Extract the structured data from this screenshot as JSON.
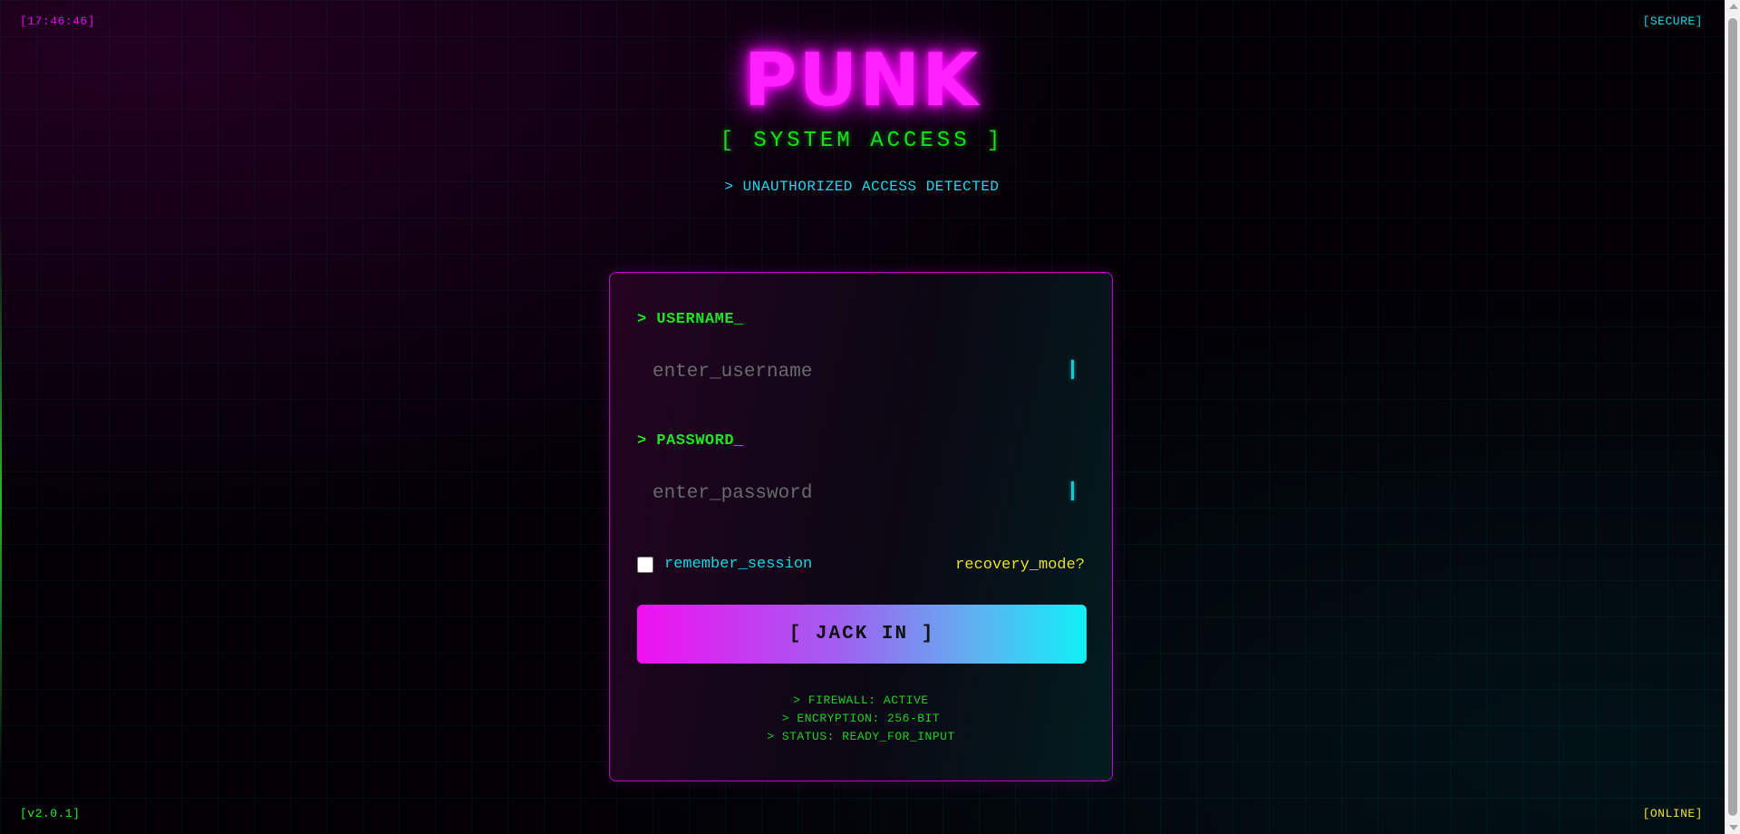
{
  "hud": {
    "clock": "[17:46:46]",
    "security": "[SECURE]",
    "version": "[v2.0.1]",
    "connection": "[ONLINE]"
  },
  "header": {
    "logo": "PUNK",
    "subtitle": "[ SYSTEM ACCESS ]",
    "alert": "> UNAUTHORIZED ACCESS DETECTED"
  },
  "form": {
    "username_label": "> USERNAME_",
    "username_placeholder": "enter_username",
    "username_value": "",
    "password_label": "> PASSWORD_",
    "password_placeholder": "enter_password",
    "password_value": "",
    "remember_label": "remember_session",
    "remember_checked": false,
    "recovery_link": "recovery_mode?",
    "submit_label": "[ JACK IN ]"
  },
  "status": {
    "firewall": "> FIREWALL: ACTIVE",
    "encryption": "> ENCRYPTION: 256-BIT",
    "state": "> STATUS: READY_FOR_INPUT"
  },
  "colors": {
    "neon_magenta": "#ff22ff",
    "neon_green": "#1ee61e",
    "neon_cyan": "#18d8ee",
    "neon_yellow": "#e8e020",
    "button_gradient_start": "#f010f0",
    "button_gradient_end": "#10f0f8",
    "panel_border": "#c400c8"
  }
}
